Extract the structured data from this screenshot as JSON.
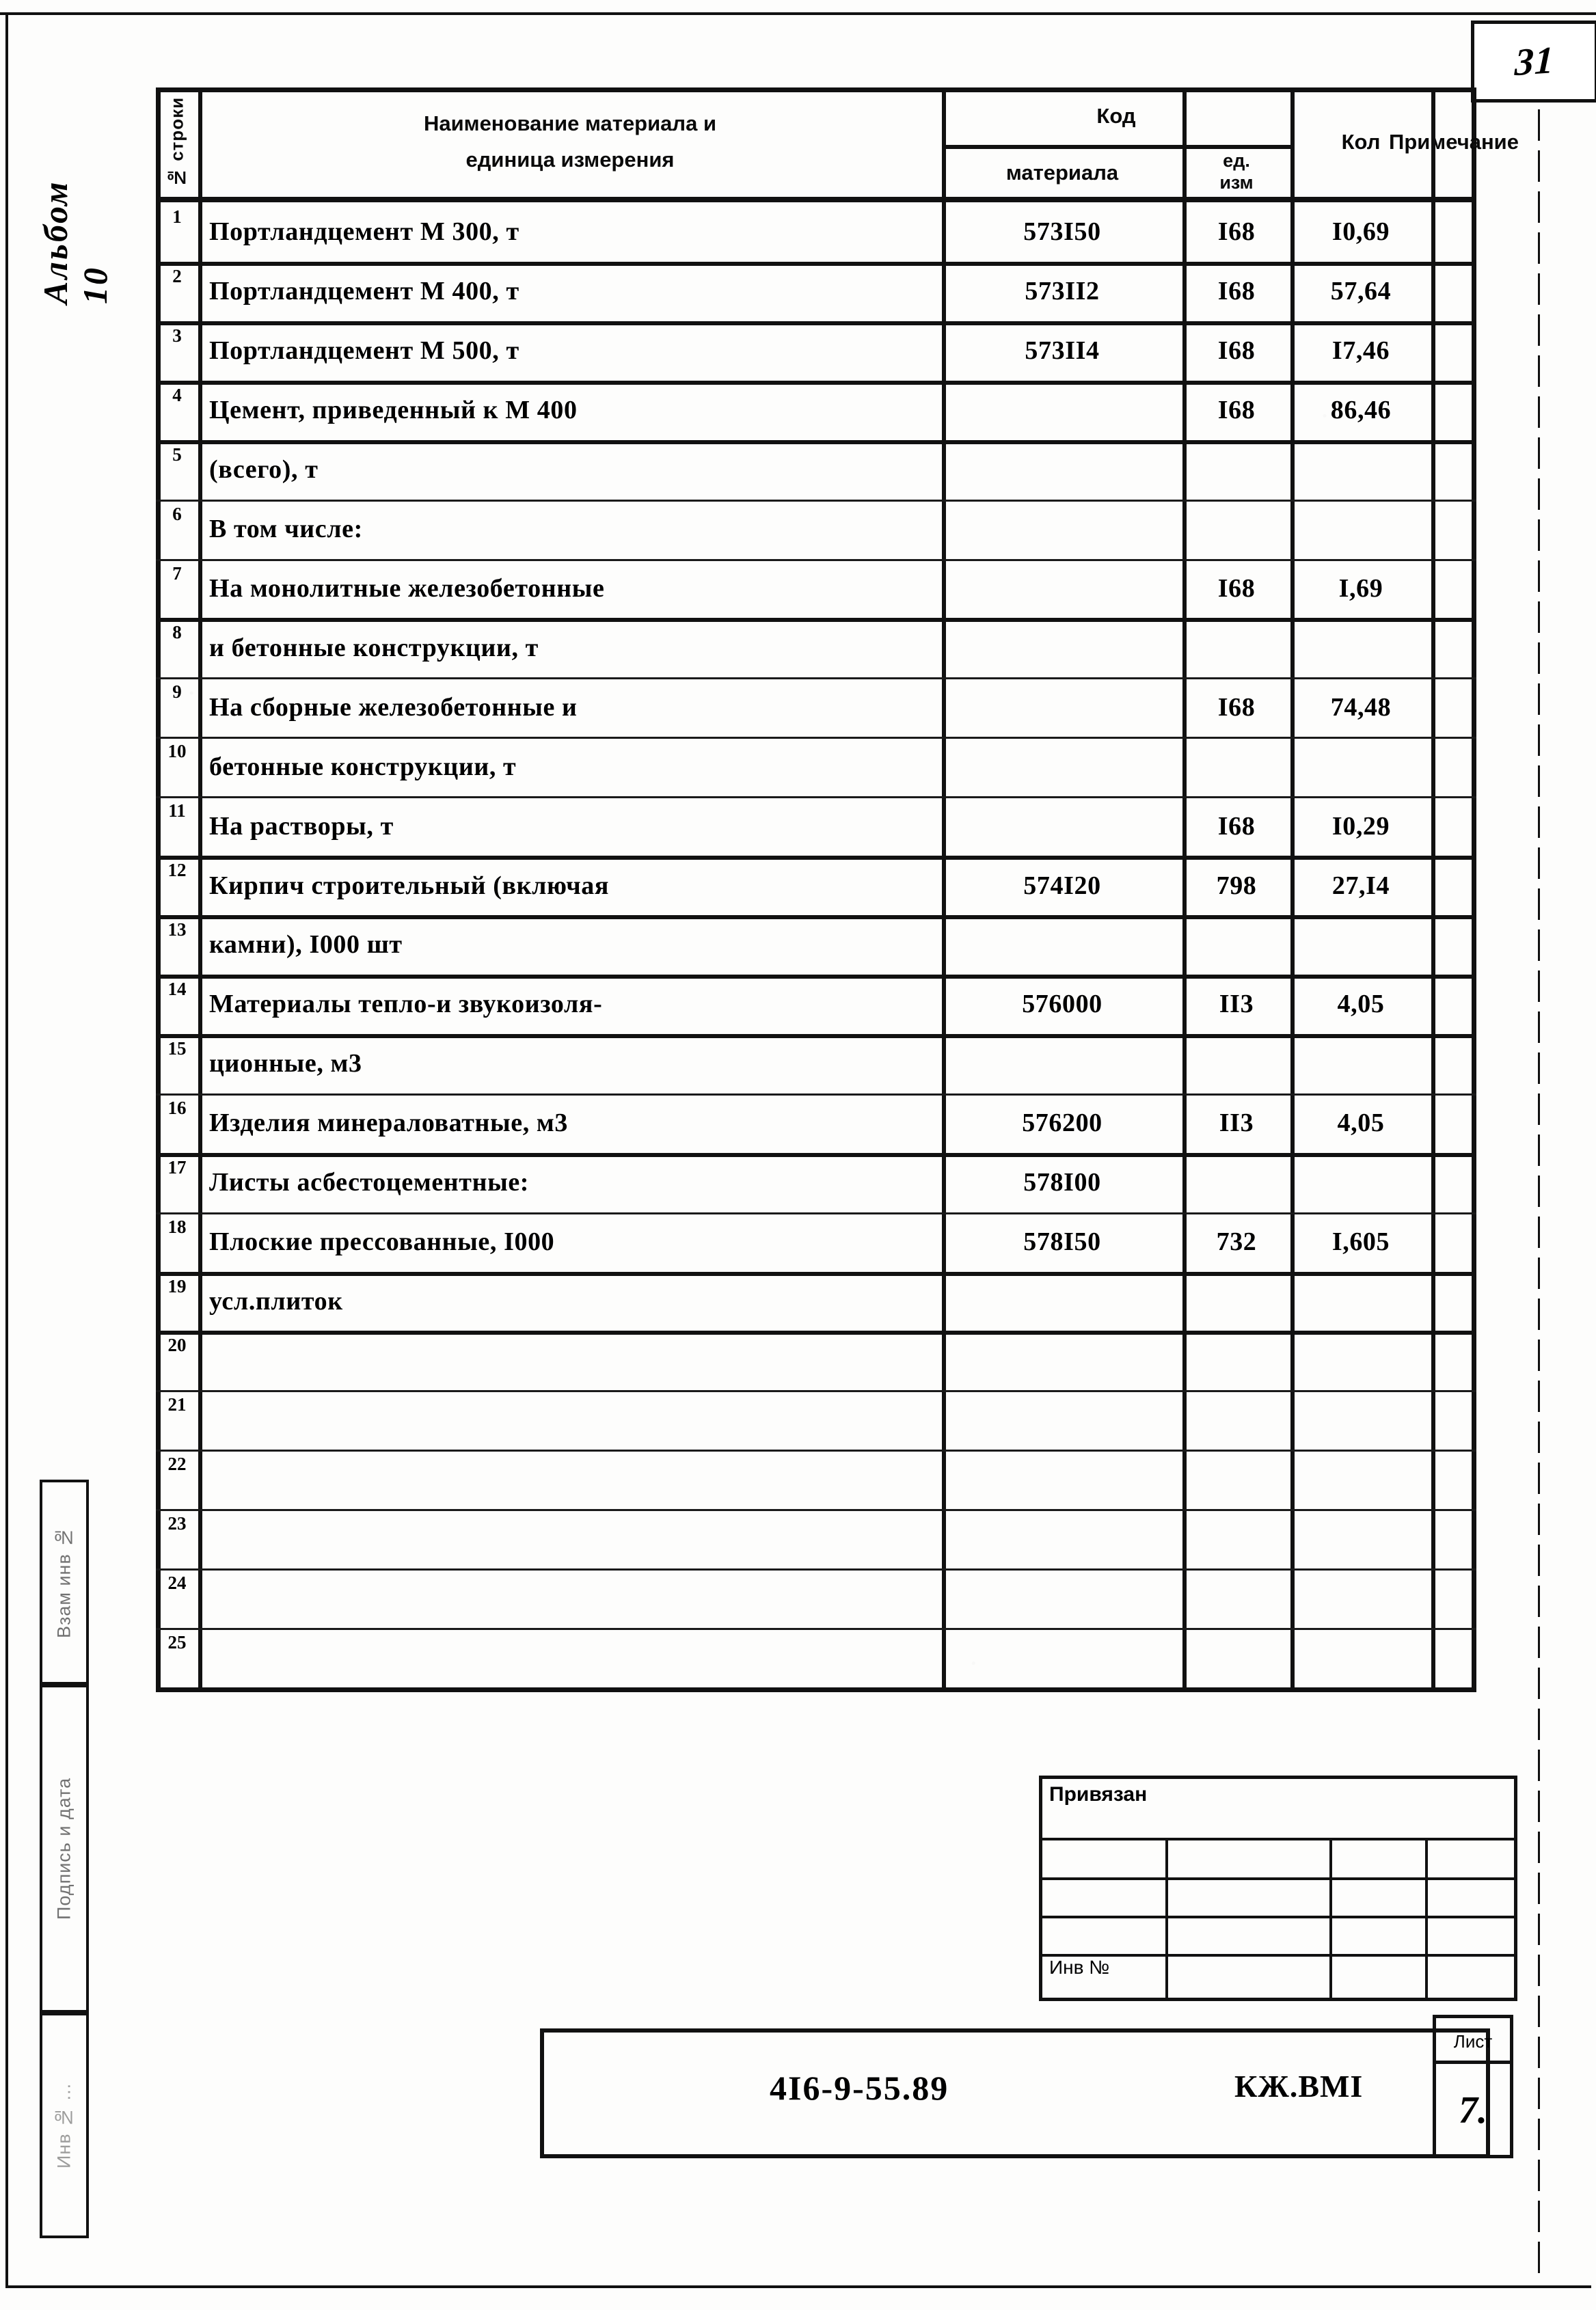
{
  "page": {
    "number": "31",
    "album_label": "Альбом 10"
  },
  "table": {
    "header": {
      "row_no": "№ строки",
      "name_unit": "Наименование материала  и\nединица измерения",
      "name_unit_line1": "Наименование материала   и",
      "name_unit_line2": "единица измерения",
      "code": "Код",
      "code_material": "материала",
      "code_unit_line1": "ед.",
      "code_unit_line2": "изм",
      "qty": "Кол",
      "note": "Примечание"
    },
    "rows": [
      {
        "no": "1",
        "name": "Портландцемент М 300, т",
        "code": "573I50",
        "unit": "I68",
        "qty": "I0,69",
        "note": ""
      },
      {
        "no": "2",
        "name": "Портландцемент М 400, т",
        "code": "573II2",
        "unit": "I68",
        "qty": "57,64",
        "note": ""
      },
      {
        "no": "3",
        "name": "Портландцемент М 500, т",
        "code": "573II4",
        "unit": "I68",
        "qty": "I7,46",
        "note": ""
      },
      {
        "no": "4",
        "name": "Цемент, приведенный к М 400",
        "code": "",
        "unit": "I68",
        "qty": "86,46",
        "note": ""
      },
      {
        "no": "5",
        "name": "(всего), т",
        "code": "",
        "unit": "",
        "qty": "",
        "note": ""
      },
      {
        "no": "6",
        "name": "В том числе:",
        "code": "",
        "unit": "",
        "qty": "",
        "note": ""
      },
      {
        "no": "7",
        "name": "На монолитные железобетонные",
        "code": "",
        "unit": "I68",
        "qty": "I,69",
        "note": ""
      },
      {
        "no": "8",
        "name": "и бетонные конструкции, т",
        "code": "",
        "unit": "",
        "qty": "",
        "note": ""
      },
      {
        "no": "9",
        "name": "На сборные железобетонные и",
        "code": "",
        "unit": "I68",
        "qty": "74,48",
        "note": ""
      },
      {
        "no": "10",
        "name": "бетонные конструкции, т",
        "code": "",
        "unit": "",
        "qty": "",
        "note": ""
      },
      {
        "no": "11",
        "name": "На растворы, т",
        "code": "",
        "unit": "I68",
        "qty": "I0,29",
        "note": ""
      },
      {
        "no": "12",
        "name": "Кирпич строительный (включая",
        "code": "574I20",
        "unit": "798",
        "qty": "27,I4",
        "note": ""
      },
      {
        "no": "13",
        "name": "камни), I000 шт",
        "code": "",
        "unit": "",
        "qty": "",
        "note": ""
      },
      {
        "no": "14",
        "name": "Материалы тепло-и звукоизоля-",
        "code": "576000",
        "unit": "II3",
        "qty": "4,05",
        "note": ""
      },
      {
        "no": "15",
        "name": "ционные, м3",
        "code": "",
        "unit": "",
        "qty": "",
        "note": ""
      },
      {
        "no": "16",
        "name": "Изделия минераловатные, м3",
        "code": "576200",
        "unit": "II3",
        "qty": "4,05",
        "note": ""
      },
      {
        "no": "17",
        "name": "Листы асбестоцементные:",
        "code": "578I00",
        "unit": "",
        "qty": "",
        "note": ""
      },
      {
        "no": "18",
        "name": "Плоские прессованные, I000",
        "code": "578I50",
        "unit": "732",
        "qty": "I,605",
        "note": ""
      },
      {
        "no": "19",
        "name": "усл.плиток",
        "code": "",
        "unit": "",
        "qty": "",
        "note": ""
      },
      {
        "no": "20",
        "name": "",
        "code": "",
        "unit": "",
        "qty": "",
        "note": ""
      },
      {
        "no": "21",
        "name": "",
        "code": "",
        "unit": "",
        "qty": "",
        "note": ""
      },
      {
        "no": "22",
        "name": "",
        "code": "",
        "unit": "",
        "qty": "",
        "note": ""
      },
      {
        "no": "23",
        "name": "",
        "code": "",
        "unit": "",
        "qty": "",
        "note": ""
      },
      {
        "no": "24",
        "name": "",
        "code": "",
        "unit": "",
        "qty": "",
        "note": ""
      },
      {
        "no": "25",
        "name": "",
        "code": "",
        "unit": "",
        "qty": "",
        "note": ""
      }
    ]
  },
  "margin": {
    "vzam_inv": "Взам инв №",
    "podpis_data": "Подпись и дата",
    "inv_no": "Инв № ..."
  },
  "title_block": {
    "privyazan": "Привязан",
    "inv_no": "Инв №",
    "doc_number": "4I6-9-55.89",
    "mark": "КЖ.ВМI",
    "list_label": "Лист",
    "list_value": "7."
  }
}
